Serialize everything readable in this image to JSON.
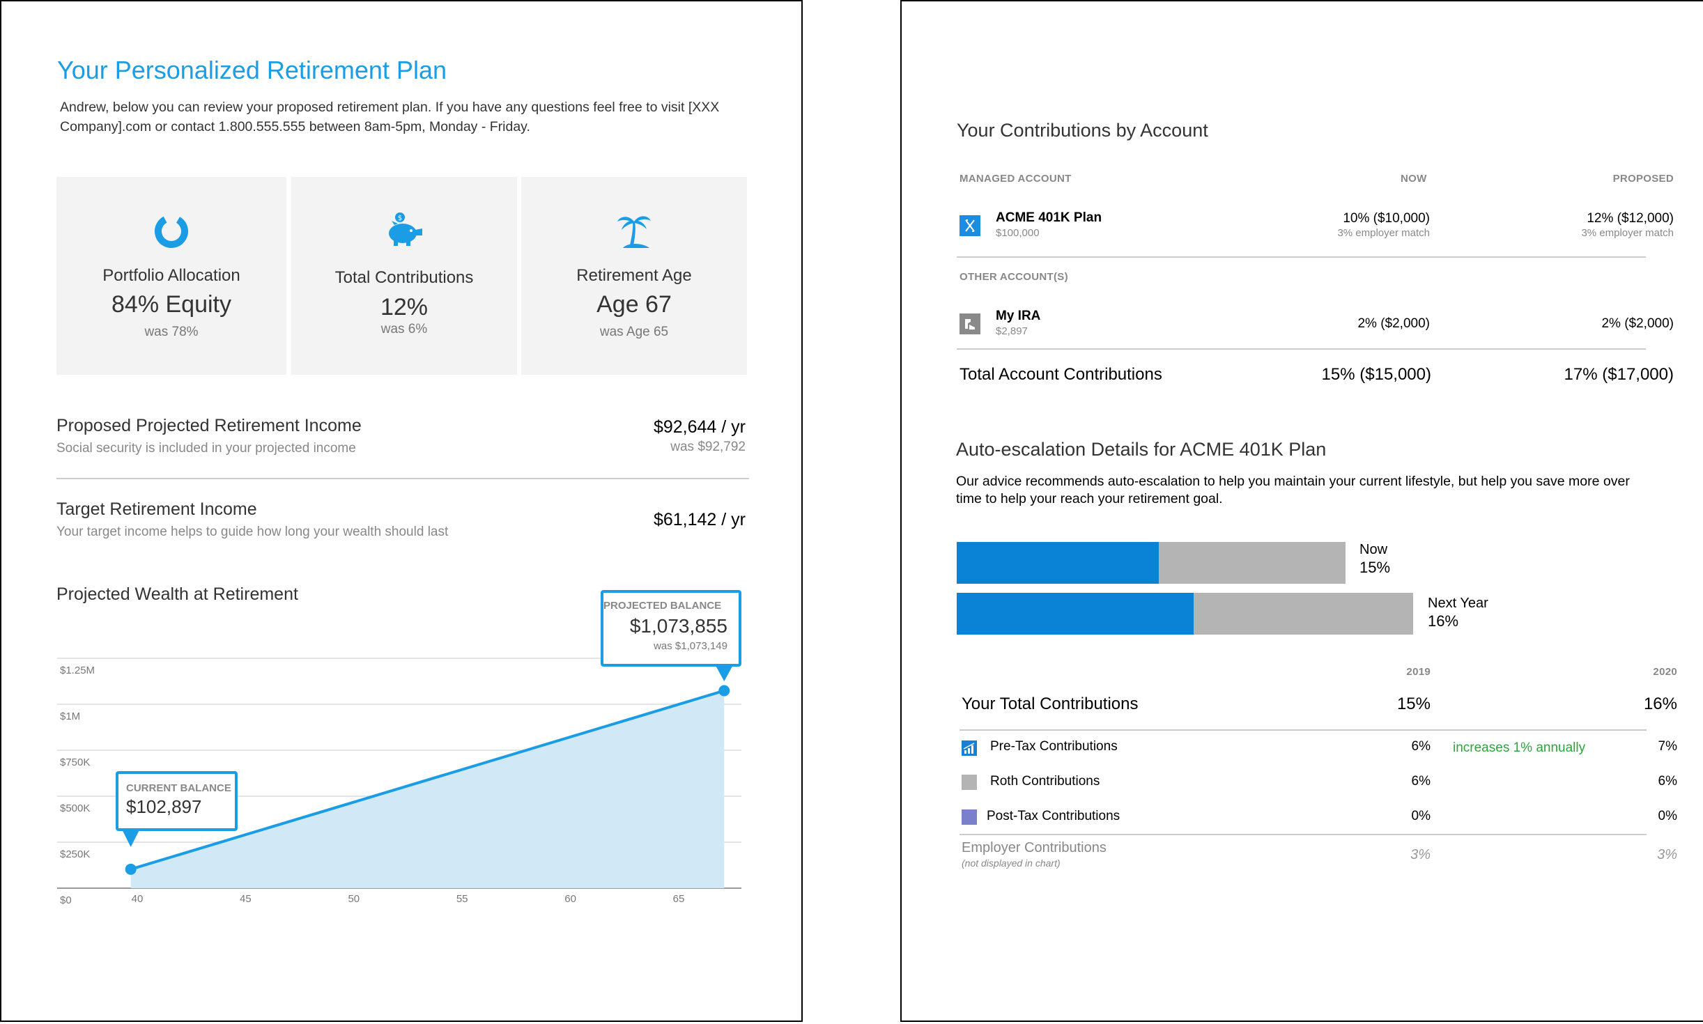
{
  "left": {
    "title": "Your Personalized Retirement Plan",
    "intro": "Andrew, below you can review your proposed retirement plan. If you have any questions feel free to visit [XXX Company].com or contact 1.800.555.555 between 8am-5pm, Monday - Friday.",
    "cards": [
      {
        "icon": "donut-chart-icon",
        "label": "Portfolio Allocation",
        "value": "84% Equity",
        "was": "was 78%"
      },
      {
        "icon": "piggy-bank-icon",
        "label": "Total Contributions",
        "value": "12%",
        "was": "was 6%"
      },
      {
        "icon": "palm-tree-island-icon",
        "label": "Retirement Age",
        "value": "Age 67",
        "was": "was Age 65"
      }
    ],
    "income": {
      "label": "Proposed Projected Retirement Income",
      "sub": "Social security is included in your projected income",
      "value": "$92,644 / yr",
      "was": "was $92,792"
    },
    "target": {
      "label": "Target Retirement Income",
      "sub": "Your target income helps to guide how long your wealth should last",
      "value": "$61,142 / yr"
    },
    "wealth_title": "Projected Wealth at Retirement"
  },
  "chart_data": {
    "type": "area",
    "title": "Projected Wealth at Retirement",
    "x": [
      39.7,
      67.1
    ],
    "values": [
      102897,
      1073855
    ],
    "xticks": [
      "40",
      "45",
      "50",
      "55",
      "60",
      "65"
    ],
    "yticks": [
      "$0",
      "$250K",
      "$500K",
      "$750K",
      "$1M",
      "$1.25M"
    ],
    "xlim": [
      37,
      68
    ],
    "ylim": [
      0,
      1250000
    ],
    "grid": true,
    "annotations": {
      "current": {
        "label": "CURRENT BALANCE",
        "value": "$102,897"
      },
      "projected": {
        "label": "PROJECTED BALANCE",
        "value": "$1,073,855",
        "was": "was $1,073,149"
      }
    },
    "colors": {
      "line": "#1b9de5",
      "fill": "#d1e8f7"
    }
  },
  "right": {
    "contrib_title": "Your Contributions by Account",
    "col_managed": "MANAGED ACCOUNT",
    "col_now": "NOW",
    "col_proposed": "PROPOSED",
    "managed": {
      "name": "ACME 401K Plan",
      "balance": "$100,000",
      "now": "10% ($10,000)",
      "now_match": "3% employer match",
      "proposed": "12% ($12,000)",
      "proposed_match": "3% employer match",
      "icon": "acme-plan-icon"
    },
    "other_label": "OTHER ACCOUNT(S)",
    "other": {
      "name": "My IRA",
      "balance": "$2,897",
      "now": "2% ($2,000)",
      "proposed": "2% ($2,000)",
      "icon": "ira-account-icon"
    },
    "total": {
      "label": "Total Account Contributions",
      "now": "15% ($15,000)",
      "proposed": "17% ($17,000)"
    },
    "auto_title": "Auto-escalation Details for ACME 401K Plan",
    "auto_desc": "Our advice recommends auto-escalation to help you maintain your current lifestyle, but help you save more over time to help your reach your retirement goal.",
    "bars": [
      {
        "label": "Now",
        "pct": "15%",
        "blue_fraction": 0.52
      },
      {
        "label": "Next Year",
        "pct": "16%",
        "blue_fraction": 0.52
      }
    ],
    "years": [
      "2019",
      "2020"
    ],
    "your_total": {
      "label": "Your Total Contributions",
      "y1": "15%",
      "y2": "16%"
    },
    "rows": [
      {
        "label": "Pre-Tax Contributions",
        "y1": "6%",
        "note": "increases 1% annually",
        "y2": "7%",
        "icon": "bar-chart-icon",
        "color": "#1b7fd1"
      },
      {
        "label": "Roth Contributions",
        "y1": "6%",
        "note": "",
        "y2": "6%",
        "color": "#b4b4b4"
      },
      {
        "label": "Post-Tax Contributions",
        "y1": "0%",
        "note": "",
        "y2": "0%",
        "color": "#7b80cc"
      }
    ],
    "employer": {
      "label": "Employer Contributions",
      "note": "(not displayed in chart)",
      "y1": "3%",
      "y2": "3%"
    },
    "colors": {
      "blue": "#0a82d6",
      "grey": "#b4b4b4",
      "green": "#2aa63a"
    }
  }
}
